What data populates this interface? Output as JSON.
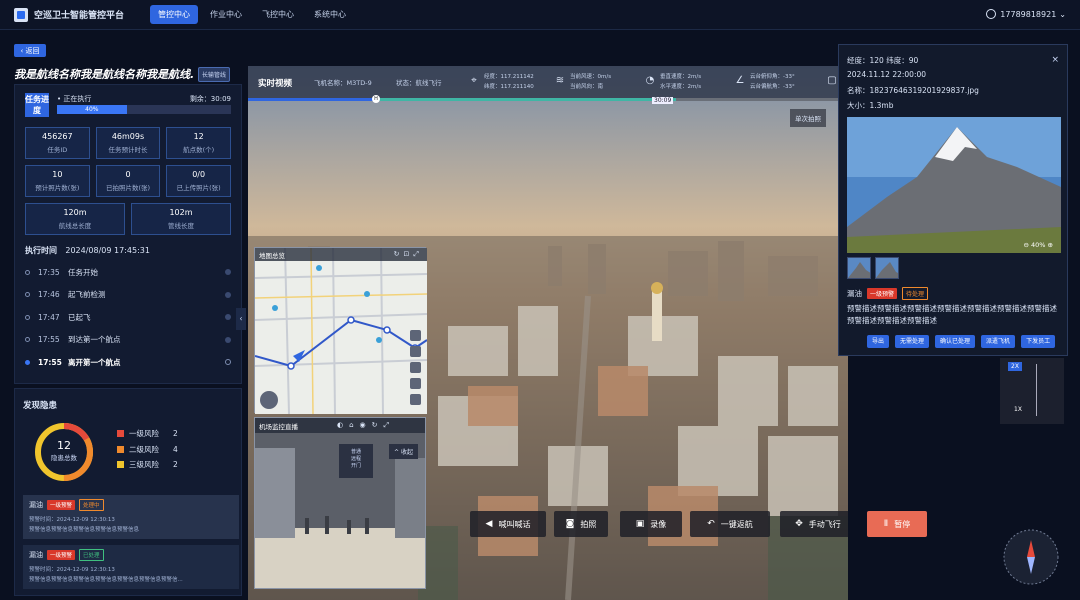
{
  "app": {
    "name": "空巡卫士智能管控平台",
    "user": "17789818921"
  },
  "nav": [
    {
      "label": "管控中心",
      "active": true
    },
    {
      "label": "作业中心"
    },
    {
      "label": "飞控中心"
    },
    {
      "label": "系统中心"
    }
  ],
  "back_label": "返回",
  "route": {
    "title": "我是航线名称我是航线名称我是航线...",
    "tag": "长输管线"
  },
  "task": {
    "progress_label": "任务进度",
    "status": "正在执行",
    "remaining": "剩余：30:09",
    "percent_label": "40%",
    "percent": 40,
    "stats": [
      {
        "value": "456267",
        "label": "任务ID"
      },
      {
        "value": "46m09s",
        "label": "任务预计时长"
      },
      {
        "value": "12",
        "label": "航点数(个)"
      },
      {
        "value": "10",
        "label": "预计照片数(张)"
      },
      {
        "value": "0",
        "label": "已拍照片数(张)"
      },
      {
        "value": "0/0",
        "label": "已上传照片(张)"
      }
    ],
    "stats2": [
      {
        "value": "120m",
        "label": "航线总长度"
      },
      {
        "value": "102m",
        "label": "管线长度"
      }
    ]
  },
  "exec": {
    "label": "执行时间",
    "time": "2024/08/09 17:45:31",
    "items": [
      {
        "time": "17:35",
        "text": "任务开始"
      },
      {
        "time": "17:46",
        "text": "起飞前检测"
      },
      {
        "time": "17:47",
        "text": "已起飞"
      },
      {
        "time": "17:55",
        "text": "到达第一个航点"
      },
      {
        "time": "17:55",
        "text": "离开第一个航点",
        "current": true
      }
    ]
  },
  "hazards": {
    "title": "发现隐患",
    "total": "12",
    "total_label": "隐患总数",
    "levels": [
      {
        "label": "一级风险",
        "count": "2",
        "color": "#e64a3b"
      },
      {
        "label": "二级风险",
        "count": "4",
        "color": "#f08a2d"
      },
      {
        "label": "三级风险",
        "count": "2",
        "color": "#f0c52d"
      }
    ],
    "cards": [
      {
        "title": "漏油",
        "level": "一级预警",
        "status": "处理中",
        "time": "预警时间：2024-12-09 12:30:13",
        "desc": "预警信息预警信息预警信息预警信息预警信息"
      },
      {
        "title": "漏油",
        "level": "一级预警",
        "status": "已处理",
        "time": "预警时间：2024-12-09 12:30:13",
        "desc": "预警信息预警信息预警信息预警信息预警信息预警信息预警信..."
      }
    ]
  },
  "video": {
    "title": "实时视频",
    "plane": "飞机名称：M3TD-9",
    "status": "状态：航线飞行",
    "lng": "经度：117.211142",
    "lat": "纬度：117.211140",
    "wind_speed": "当前风速：0m/s",
    "wind_dir": "当前风向：南",
    "vspeed": "垂直速度：2m/s",
    "hspeed": "水平速度：2m/s",
    "gimbal_pitch": "云台俯仰角：-33°",
    "gimbal_yaw": "云台偏航角：-33°",
    "timeline_label": "30:09",
    "knob_label": "H",
    "single_shot": "单次拍照"
  },
  "map": {
    "title": "地图总览"
  },
  "camera": {
    "title": "机场监控直播",
    "popup": "普通\n远程\n开门",
    "fold": "收起"
  },
  "controls": [
    {
      "label": "喊叫喊话",
      "icon": "speaker-icon"
    },
    {
      "label": "拍照",
      "icon": "camera-icon"
    },
    {
      "label": "录像",
      "icon": "video-icon"
    },
    {
      "label": "一键返航",
      "icon": "return-icon"
    },
    {
      "label": "手动飞行",
      "icon": "joystick-icon"
    },
    {
      "label": "暂停",
      "icon": "pause-icon"
    }
  ],
  "zoom_panel": {
    "z2": "2X",
    "z1": "1X"
  },
  "photo": {
    "lng_lat": "经度：120    纬度：90",
    "time": "2024.11.12 22:00:00",
    "name": "名称：1823764631920​1929837.jpg",
    "size": "大小：1.3mb",
    "zoom": "40%",
    "label": "漏油",
    "level": "一级预警",
    "status": "待处理",
    "desc": "预警描述预警描述预警描述预警描述预警描述预警描述预警描述预警描述预警描述预警描述",
    "actions": [
      "导出",
      "无需处理",
      "确认已处理",
      "派遣飞机",
      "下发员工"
    ]
  }
}
